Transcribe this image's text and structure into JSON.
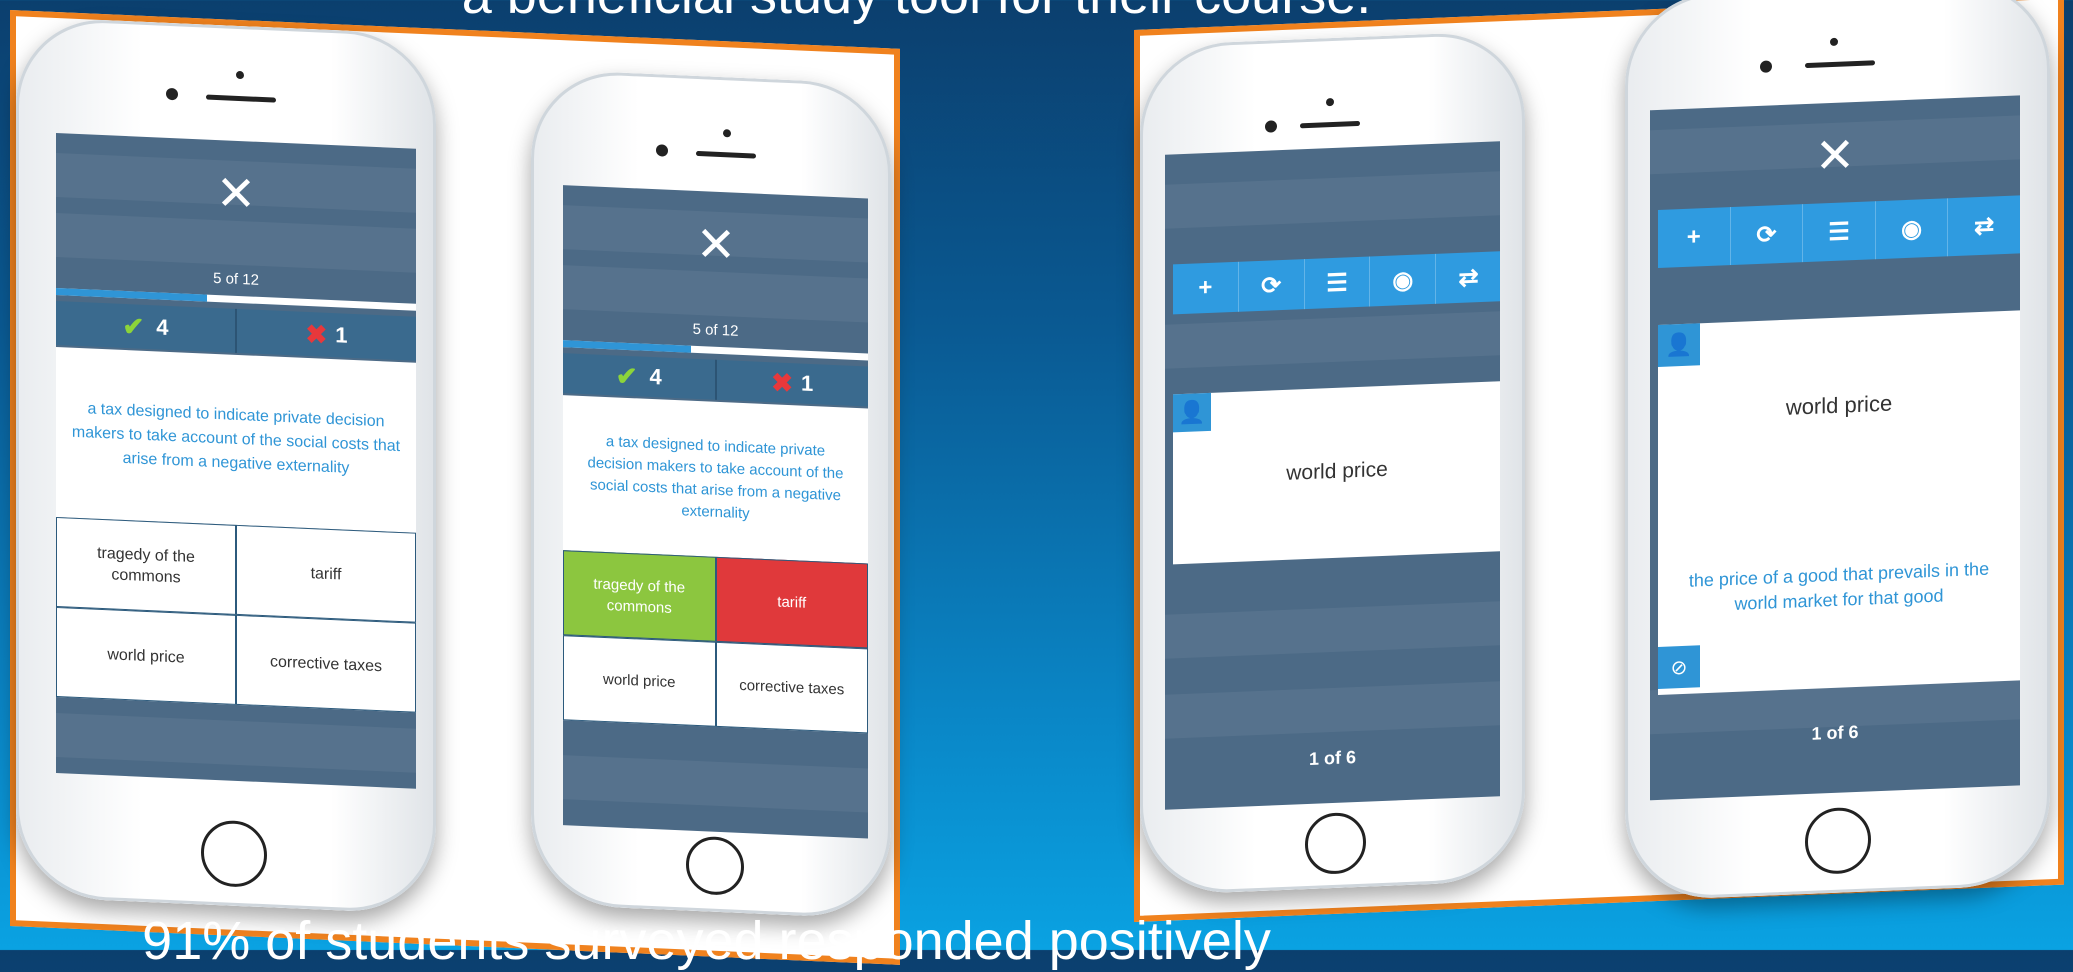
{
  "captions": {
    "top": "a beneficial study tool for their course.",
    "bottom": "91% of students surveyed responded positively"
  },
  "colors": {
    "panel_border": "#f0821e",
    "accent_blue": "#2f95d6",
    "correct_green": "#8cc63f",
    "wrong_red": "#e0393b"
  },
  "quiz": {
    "close_icon": "close-icon",
    "counter": "5 of 12",
    "progress": 0.42,
    "correct_count": "4",
    "wrong_count": "1",
    "question": "a tax designed to indicate private decision makers to take account of the social costs that arise from a negative externality",
    "answers": [
      "tragedy of the commons",
      "tariff",
      "world price",
      "corrective taxes"
    ]
  },
  "flashcards": {
    "toolbar_icons": [
      "plus-icon",
      "refresh-icon",
      "checklist-icon",
      "eye-icon",
      "shuffle-icon"
    ],
    "term": "world price",
    "definition": "the price of a good that prevails in the world market for that good",
    "pager": "1 of 6"
  }
}
